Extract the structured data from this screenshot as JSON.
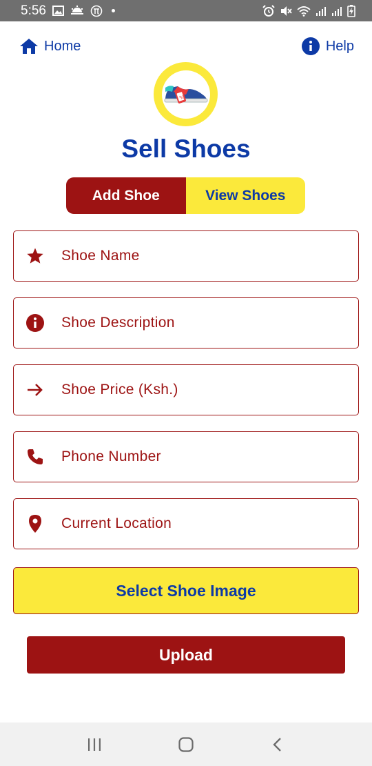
{
  "status_bar": {
    "time": "5:56",
    "left_icons": [
      "image-icon",
      "weather-icon",
      "pi-icon"
    ],
    "right_icons": [
      "alarm-icon",
      "mute-icon",
      "wifi-icon",
      "signal-icon",
      "signal-icon",
      "battery-icon"
    ]
  },
  "nav": {
    "home_label": "Home",
    "help_label": "Help"
  },
  "title": "Sell Shoes",
  "tabs": {
    "add": "Add Shoe",
    "view": "View Shoes",
    "active": "add"
  },
  "form": {
    "fields": [
      {
        "name": "shoe-name",
        "icon": "star-icon",
        "placeholder": "Shoe Name",
        "value": ""
      },
      {
        "name": "shoe-description",
        "icon": "info-icon",
        "placeholder": "Shoe Description",
        "value": ""
      },
      {
        "name": "shoe-price",
        "icon": "arrow-right-icon",
        "placeholder": "Shoe Price (Ksh.)",
        "value": ""
      },
      {
        "name": "phone-number",
        "icon": "phone-icon",
        "placeholder": "Phone Number",
        "value": ""
      },
      {
        "name": "current-location",
        "icon": "location-pin-icon",
        "placeholder": "Current Location",
        "value": ""
      }
    ],
    "select_image_label": "Select Shoe Image",
    "upload_label": "Upload"
  },
  "system_nav": [
    "recent-apps-icon",
    "home-circle-icon",
    "back-icon"
  ],
  "colors": {
    "primary_blue": "#0d3aa6",
    "accent_red": "#9d1313",
    "accent_yellow": "#fbe93b",
    "status_bar": "#6f6f6f",
    "nav_bar": "#f1f1f1"
  }
}
